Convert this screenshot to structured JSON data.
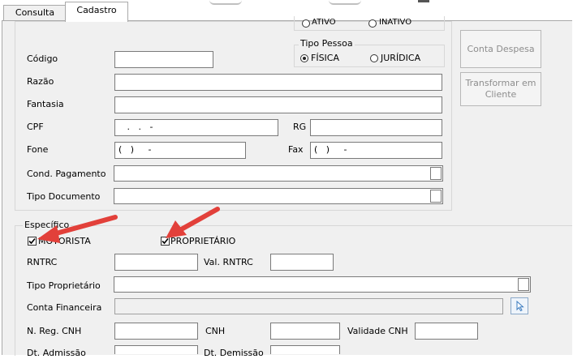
{
  "tabs": [
    {
      "label": "Consulta"
    },
    {
      "label": "Cadastro"
    }
  ],
  "status_group": {
    "ativo_label": "ATIVO",
    "inativo_label": "INATIVO"
  },
  "tipo_pessoa": {
    "title": "Tipo Pessoa",
    "fisica_label": "FÍSICA",
    "juridica_label": "JURÍDICA",
    "selected": "FÍSICA"
  },
  "form": {
    "codigo_label": "Código",
    "codigo_value": "",
    "razao_label": "Razão",
    "razao_value": "",
    "fantasia_label": "Fantasia",
    "fantasia_value": "",
    "cpf_label": "CPF",
    "cpf_value": "   .   .   -",
    "rg_label": "RG",
    "rg_value": "",
    "fone_label": "Fone",
    "fone_value": "(   )     -",
    "fax_label": "Fax",
    "fax_value": "(   )     -",
    "cond_pagamento_label": "Cond. Pagamento",
    "cond_pagamento_value": "",
    "tipo_documento_label": "Tipo Documento",
    "tipo_documento_value": ""
  },
  "buttons": {
    "conta_despesa": "Conta Despesa",
    "transformar_cliente": "Transformar em Cliente"
  },
  "especifico": {
    "title": "Específico",
    "motorista_label": "MOTORISTA",
    "motorista_checked": true,
    "proprietario_label": "PROPRIETÁRIO",
    "proprietario_checked": true,
    "rntrc_label": "RNTRC",
    "rntrc_value": "",
    "val_rntrc_label": "Val. RNTRC",
    "val_rntrc_value": "",
    "tipo_proprietario_label": "Tipo Proprietário",
    "tipo_proprietario_value": "",
    "conta_financeira_label": "Conta Financeira",
    "conta_financeira_value": "",
    "n_reg_cnh_label": "N. Reg. CNH",
    "n_reg_cnh_value": "",
    "cnh_label": "CNH",
    "cnh_value": "",
    "validade_cnh_label": "Validade CNH",
    "validade_cnh_value": "",
    "dt_admissao_label": "Dt. Admissão",
    "dt_demissao_label": "Dt. Demissão"
  },
  "icons": {
    "dropdown": "chevron-down-icon",
    "lookup": "cursor-lookup-icon",
    "annotation": "red-arrow-icon"
  },
  "colors": {
    "annotation_arrow": "#e2403a",
    "panel_bg": "#f0f0f0",
    "lookup_button": "#cfe3f7"
  }
}
